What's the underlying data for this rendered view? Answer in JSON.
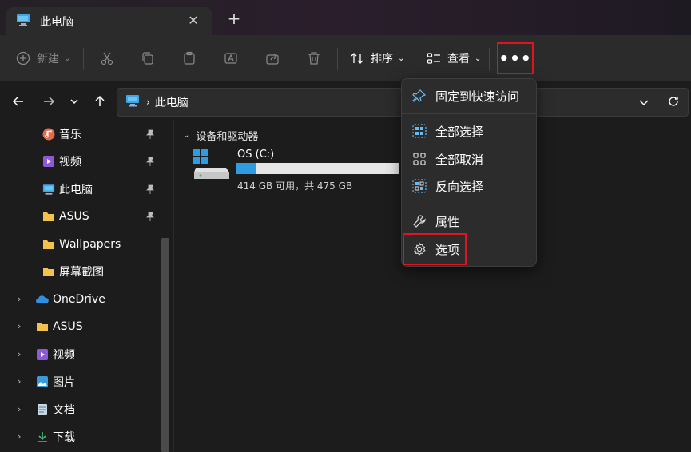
{
  "window": {
    "tab_title": "此电脑",
    "new_tab_glyph": "+",
    "close_glyph": "✕"
  },
  "toolbar": {
    "new_label": "新建",
    "sort_label": "排序",
    "view_label": "查看",
    "more_glyph": "•••",
    "icons": [
      "plus-circle-icon",
      "cut-icon",
      "copy-icon",
      "paste-icon",
      "rename-icon",
      "share-icon",
      "delete-icon",
      "sort-icon",
      "view-icon",
      "more-icon"
    ]
  },
  "address": {
    "path_label": "此电脑",
    "separator": "›"
  },
  "sidebar": {
    "quick_access": [
      {
        "label": "音乐",
        "icon": "music-icon",
        "pinned": true
      },
      {
        "label": "视频",
        "icon": "video-icon",
        "pinned": true
      },
      {
        "label": "此电脑",
        "icon": "computer-icon",
        "pinned": true
      },
      {
        "label": "ASUS",
        "icon": "folder-icon",
        "pinned": true
      },
      {
        "label": "Wallpapers",
        "icon": "folder-icon",
        "pinned": false
      },
      {
        "label": "屏幕截图",
        "icon": "folder-icon",
        "pinned": false
      }
    ],
    "tree": [
      {
        "label": "OneDrive",
        "icon": "onedrive-icon"
      },
      {
        "label": "ASUS",
        "icon": "folder-icon"
      },
      {
        "label": "视频",
        "icon": "video-icon"
      },
      {
        "label": "图片",
        "icon": "pictures-icon"
      },
      {
        "label": "文档",
        "icon": "documents-icon"
      },
      {
        "label": "下载",
        "icon": "download-icon"
      }
    ],
    "pin_glyph": "📌",
    "expand_glyph": "›"
  },
  "content": {
    "section_title": "设备和驱动器",
    "drive": {
      "name": "OS (C:)",
      "free_text": "414 GB 可用，共 475 GB",
      "used_fraction": 0.128
    }
  },
  "menu": {
    "items": [
      {
        "label": "固定到快速访问",
        "icon": "pin-icon"
      },
      {
        "label": "全部选择",
        "icon": "select-all-icon"
      },
      {
        "label": "全部取消",
        "icon": "select-none-icon"
      },
      {
        "label": "反向选择",
        "icon": "invert-selection-icon"
      },
      {
        "label": "属性",
        "icon": "wrench-icon"
      },
      {
        "label": "选项",
        "icon": "gear-icon"
      }
    ]
  },
  "colors": {
    "accent": "#2f9be0",
    "highlight": "#e0141e",
    "folder": "#f2c14e"
  }
}
